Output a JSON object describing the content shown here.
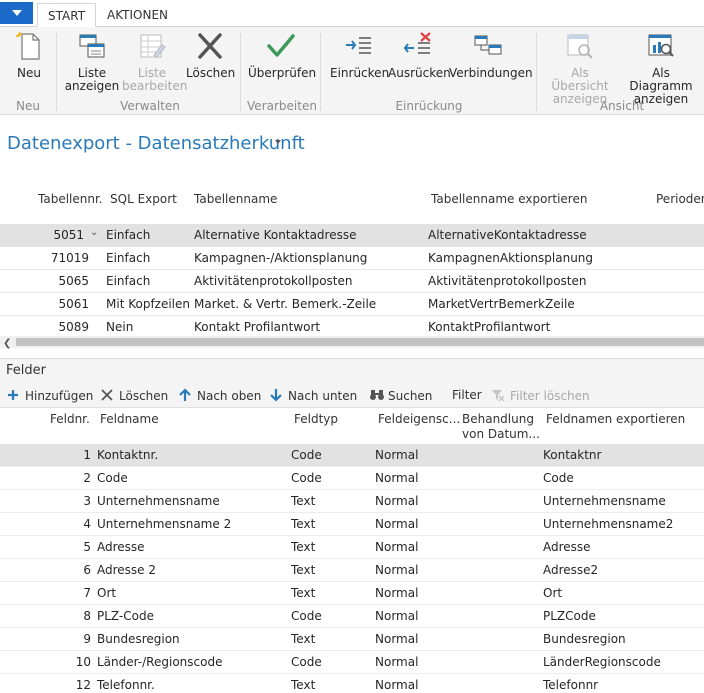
{
  "tabs": [
    {
      "label": "START",
      "active": true
    },
    {
      "label": "AKTIONEN",
      "active": false
    }
  ],
  "ribbon": {
    "buttons": [
      {
        "label1": "Neu",
        "label2": "",
        "icon": "new-document-icon",
        "disabled": false
      },
      {
        "label1": "Liste",
        "label2": "anzeigen",
        "icon": "list-view-icon",
        "disabled": false
      },
      {
        "label1": "Liste",
        "label2": "bearbeiten",
        "icon": "list-edit-icon",
        "disabled": true
      },
      {
        "label1": "Löschen",
        "label2": "",
        "icon": "delete-x-icon",
        "disabled": false
      },
      {
        "label1": "Überprüfen",
        "label2": "",
        "icon": "checkmark-icon",
        "disabled": false
      },
      {
        "label1": "Einrücken",
        "label2": "",
        "icon": "indent-icon",
        "disabled": false
      },
      {
        "label1": "Ausrücken",
        "label2": "",
        "icon": "outdent-icon",
        "disabled": false
      },
      {
        "label1": "Verbindungen",
        "label2": "",
        "icon": "connections-icon",
        "disabled": false
      },
      {
        "label1": "Als Übersicht",
        "label2": "anzeigen",
        "icon": "overview-icon",
        "disabled": true
      },
      {
        "label1": "Als Diagramm",
        "label2": "anzeigen",
        "icon": "chart-icon",
        "disabled": false
      }
    ],
    "groups": [
      "Neu",
      "Verwalten",
      "Verarbeiten",
      "Einrückung",
      "Ansicht"
    ]
  },
  "page": {
    "title": "Datenexport - Datensatzherkunft"
  },
  "upper": {
    "headers": [
      "Tabellennr.",
      "SQL Export",
      "Tabellenname",
      "Tabellenname exportieren",
      "Perioden"
    ],
    "rows": [
      {
        "nr": "5051",
        "sql": "Einfach",
        "name": "Alternative Kontaktadresse",
        "export": "AlternativeKontaktadresse",
        "selected": true
      },
      {
        "nr": "71019",
        "sql": "Einfach",
        "name": "Kampagnen-/Aktionsplanung",
        "export": "KampagnenAktionsplanung",
        "selected": false
      },
      {
        "nr": "5065",
        "sql": "Einfach",
        "name": "Aktivitätenprotokollposten",
        "export": "Aktivitätenprotokollposten",
        "selected": false
      },
      {
        "nr": "5061",
        "sql": "Mit Kopfzeilen",
        "name": "Market. & Vertr. Bemerk.-Zeile",
        "export": "MarketVertrBemerkZeile",
        "selected": false
      },
      {
        "nr": "5089",
        "sql": "Nein",
        "name": "Kontakt Profilantwort",
        "export": "KontaktProfilantwort",
        "selected": false
      }
    ]
  },
  "felder": {
    "title": "Felder",
    "actions": [
      {
        "label": "Hinzufügen",
        "icon": "plus-icon",
        "disabled": false
      },
      {
        "label": "Löschen",
        "icon": "x-icon",
        "disabled": false
      },
      {
        "label": "Nach oben",
        "icon": "arrow-up-icon",
        "disabled": false
      },
      {
        "label": "Nach unten",
        "icon": "arrow-down-icon",
        "disabled": false
      },
      {
        "label": "Suchen",
        "icon": "binoculars-icon",
        "disabled": false
      },
      {
        "label": "Filter",
        "icon": "",
        "disabled": false
      },
      {
        "label": "Filter löschen",
        "icon": "clear-filter-icon",
        "disabled": true
      }
    ],
    "headers": {
      "nr": "Feldnr.",
      "name": "Feldname",
      "typ": "Feldtyp",
      "eig": "Feldeigensc...",
      "beh1": "Behandlung",
      "beh2": "von Datum...",
      "exp": "Feldnamen exportieren"
    },
    "rows": [
      {
        "nr": "1",
        "name": "Kontaktnr.",
        "typ": "Code",
        "eig": "Normal",
        "exp": "Kontaktnr",
        "selected": true
      },
      {
        "nr": "2",
        "name": "Code",
        "typ": "Code",
        "eig": "Normal",
        "exp": "Code",
        "selected": false
      },
      {
        "nr": "3",
        "name": "Unternehmensname",
        "typ": "Text",
        "eig": "Normal",
        "exp": "Unternehmensname",
        "selected": false
      },
      {
        "nr": "4",
        "name": "Unternehmensname 2",
        "typ": "Text",
        "eig": "Normal",
        "exp": "Unternehmensname2",
        "selected": false
      },
      {
        "nr": "5",
        "name": "Adresse",
        "typ": "Text",
        "eig": "Normal",
        "exp": "Adresse",
        "selected": false
      },
      {
        "nr": "6",
        "name": "Adresse 2",
        "typ": "Text",
        "eig": "Normal",
        "exp": "Adresse2",
        "selected": false
      },
      {
        "nr": "7",
        "name": "Ort",
        "typ": "Text",
        "eig": "Normal",
        "exp": "Ort",
        "selected": false
      },
      {
        "nr": "8",
        "name": "PLZ-Code",
        "typ": "Code",
        "eig": "Normal",
        "exp": "PLZCode",
        "selected": false
      },
      {
        "nr": "9",
        "name": "Bundesregion",
        "typ": "Text",
        "eig": "Normal",
        "exp": "Bundesregion",
        "selected": false
      },
      {
        "nr": "10",
        "name": "Länder-/Regionscode",
        "typ": "Code",
        "eig": "Normal",
        "exp": "LänderRegionscode",
        "selected": false
      },
      {
        "nr": "12",
        "name": "Telefonnr.",
        "typ": "Text",
        "eig": "Normal",
        "exp": "Telefonnr",
        "selected": false
      }
    ]
  },
  "colors": {
    "accent": "#2a7ab8",
    "appButton": "#1b6ac9",
    "checkGreen": "#3d9a5a",
    "deleteRed": "#e04040"
  }
}
